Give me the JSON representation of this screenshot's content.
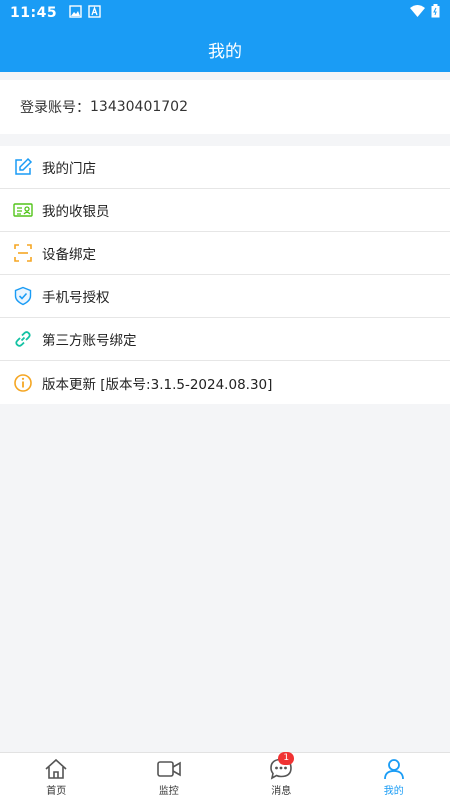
{
  "statusbar": {
    "time": "11:45"
  },
  "appbar": {
    "title": "我的"
  },
  "account": {
    "label": "登录账号：",
    "value": "13430401702"
  },
  "menu": {
    "items": [
      {
        "label": "我的门店",
        "icon": "edit-icon"
      },
      {
        "label": "我的收银员",
        "icon": "id-card-icon"
      },
      {
        "label": "设备绑定",
        "icon": "scan-icon"
      },
      {
        "label": "手机号授权",
        "icon": "shield-check-icon"
      },
      {
        "label": "第三方账号绑定",
        "icon": "link-icon"
      },
      {
        "label": "版本更新 [版本号:3.1.5-2024.08.30]",
        "icon": "info-icon"
      }
    ]
  },
  "tabbar": {
    "tabs": [
      {
        "label": "首页",
        "icon": "home-icon"
      },
      {
        "label": "监控",
        "icon": "video-icon"
      },
      {
        "label": "消息",
        "icon": "chat-icon",
        "badge": "1"
      },
      {
        "label": "我的",
        "icon": "user-icon"
      }
    ]
  },
  "colors": {
    "primary": "#1a9cf5",
    "badge": "#f03232",
    "background": "#f4f5f7"
  }
}
